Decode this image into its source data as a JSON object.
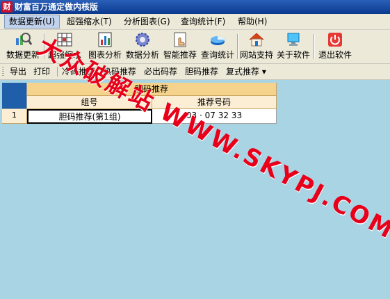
{
  "window": {
    "title": "财富百万通定做内核版",
    "app_icon_glyph": "财"
  },
  "menu": [
    {
      "label": "数据更新(U)",
      "active": true
    },
    {
      "label": "超强缩水(T)"
    },
    {
      "label": "分析图表(G)"
    },
    {
      "label": "查询统计(F)"
    },
    {
      "label": "帮助(H)"
    }
  ],
  "toolbar": [
    {
      "label": "数据更新",
      "icon": "magnifier-chart-icon"
    },
    {
      "label": "超强缩水",
      "icon": "grid-shrink-icon"
    },
    {
      "label": "图表分析",
      "icon": "chart-icon"
    },
    {
      "label": "数据分析",
      "icon": "gear-icon"
    },
    {
      "label": "智能推荐",
      "icon": "hand-pointer-icon"
    },
    {
      "label": "查询统计",
      "icon": "pie-chart-icon"
    },
    {
      "label": "网站支持",
      "icon": "home-icon"
    },
    {
      "label": "关于软件",
      "icon": "computer-info-icon"
    },
    {
      "label": "退出软件",
      "icon": "power-icon"
    }
  ],
  "toolbar2": [
    {
      "label": "导出"
    },
    {
      "label": "打印"
    },
    {
      "label": "冷码推荐"
    },
    {
      "label": "热码推荐"
    },
    {
      "label": "必出码荐"
    },
    {
      "label": "胆码推荐"
    },
    {
      "label": "复式推荐 ▾"
    }
  ],
  "grid": {
    "group_header": "胆码推荐",
    "columns": [
      "组号",
      "推荐号码"
    ],
    "rows": [
      {
        "index": "1",
        "group": "胆码推荐(第1组)",
        "numbers": "03 · 07 32 33"
      }
    ]
  },
  "watermark": "大众破解站 WWW.SKYPJ.COM",
  "colors": {
    "title_bar": "#0a3a8e",
    "background": "#a9d4e4",
    "header": "#f5d38c",
    "watermark": "#e8001b"
  }
}
